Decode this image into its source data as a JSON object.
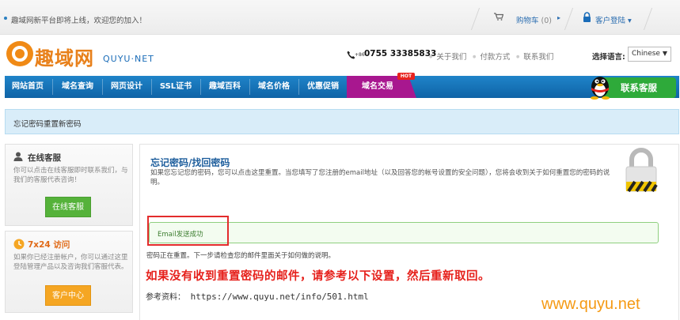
{
  "topbar": {
    "notice": "趣域网新平台即将上线，欢迎您的加入！",
    "cart_label": "购物车",
    "cart_count": "(0)",
    "login_label": "客户登陆"
  },
  "header": {
    "logo_cn": "趣域网",
    "logo_en": "QUYU·NET",
    "phone_prefix": "+86",
    "phone": "0755 33385833",
    "links": [
      "关于我们",
      "付款方式",
      "联系我们"
    ],
    "language_label": "选择语言:",
    "language_value": "Chinese"
  },
  "nav": {
    "items": [
      "网站首页",
      "域名查询",
      "网页设计",
      "SSL证书",
      "趣域百科",
      "域名价格",
      "优惠促销",
      "域名交易"
    ],
    "hot_badge": "HOT",
    "contact": "联系客服"
  },
  "breadcrumb": "忘记密码重置新密码",
  "sidebar": {
    "online": {
      "title": "在线客服",
      "text": "你可以点击在线客服即时联系我们，与我们的客服代表咨询！",
      "button": "在线客服"
    },
    "access": {
      "title": "7x24 访问",
      "text": "如果你已经注册帐户，你可以通过这里登陆管理产品以及咨询我们客服代表。",
      "button": "客户中心"
    }
  },
  "main": {
    "title": "忘记密码/找回密码",
    "description": "如果您忘记您的密码，您可以点击这里重置。当您填写了您注册的email地址（以及回答您的帐号设置的安全问题），您将会收到关于如何重置您的密码的说明。",
    "success": "Email发送成功",
    "reset_note": "密码正在重置。下一步请检查您的邮件里面关于如何做的说明。",
    "red_message": "如果没有收到重置密码的邮件，请参考以下设置，然后重新取回。",
    "ref_label": "参考资料：",
    "ref_url": "https://www.quyu.net/info/501.html"
  },
  "watermark": "www.quyu.net",
  "colors": {
    "nav_blue": "#1a78bf",
    "nav_active": "#a8178f",
    "contact_green": "#2eaa3a",
    "alert_red": "#e6211c",
    "watermark_orange": "#f59a14"
  }
}
